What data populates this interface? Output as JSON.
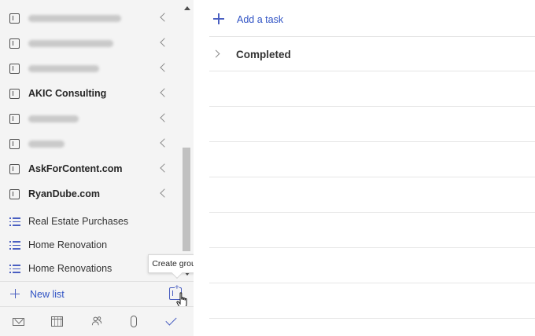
{
  "sidebar": {
    "groups": [
      {
        "label": "",
        "blurred": true
      },
      {
        "label": "",
        "blurred": true
      },
      {
        "label": "",
        "blurred": true
      },
      {
        "label": "AKIC Consulting",
        "blurred": false
      },
      {
        "label": "",
        "blurred": true
      },
      {
        "label": "",
        "blurred": true
      },
      {
        "label": "AskForContent.com",
        "blurred": false
      },
      {
        "label": "RyanDube.com",
        "blurred": false
      }
    ],
    "lists": [
      {
        "label": "Real Estate Purchases"
      },
      {
        "label": "Home Renovation"
      },
      {
        "label": "Home Renovations"
      }
    ],
    "new_list_label": "New list",
    "create_group_tooltip": "Create group"
  },
  "app_bar": {
    "icons": [
      "mail-icon",
      "calendar-icon",
      "people-icon",
      "attachment-icon",
      "todo-check-icon"
    ],
    "active": "todo-check-icon"
  },
  "main": {
    "add_task_label": "Add a task",
    "completed_label": "Completed"
  },
  "colors": {
    "accent": "#2f52c4",
    "sidebar_bg": "#f4f4f4",
    "divider": "#e6e6e6"
  }
}
